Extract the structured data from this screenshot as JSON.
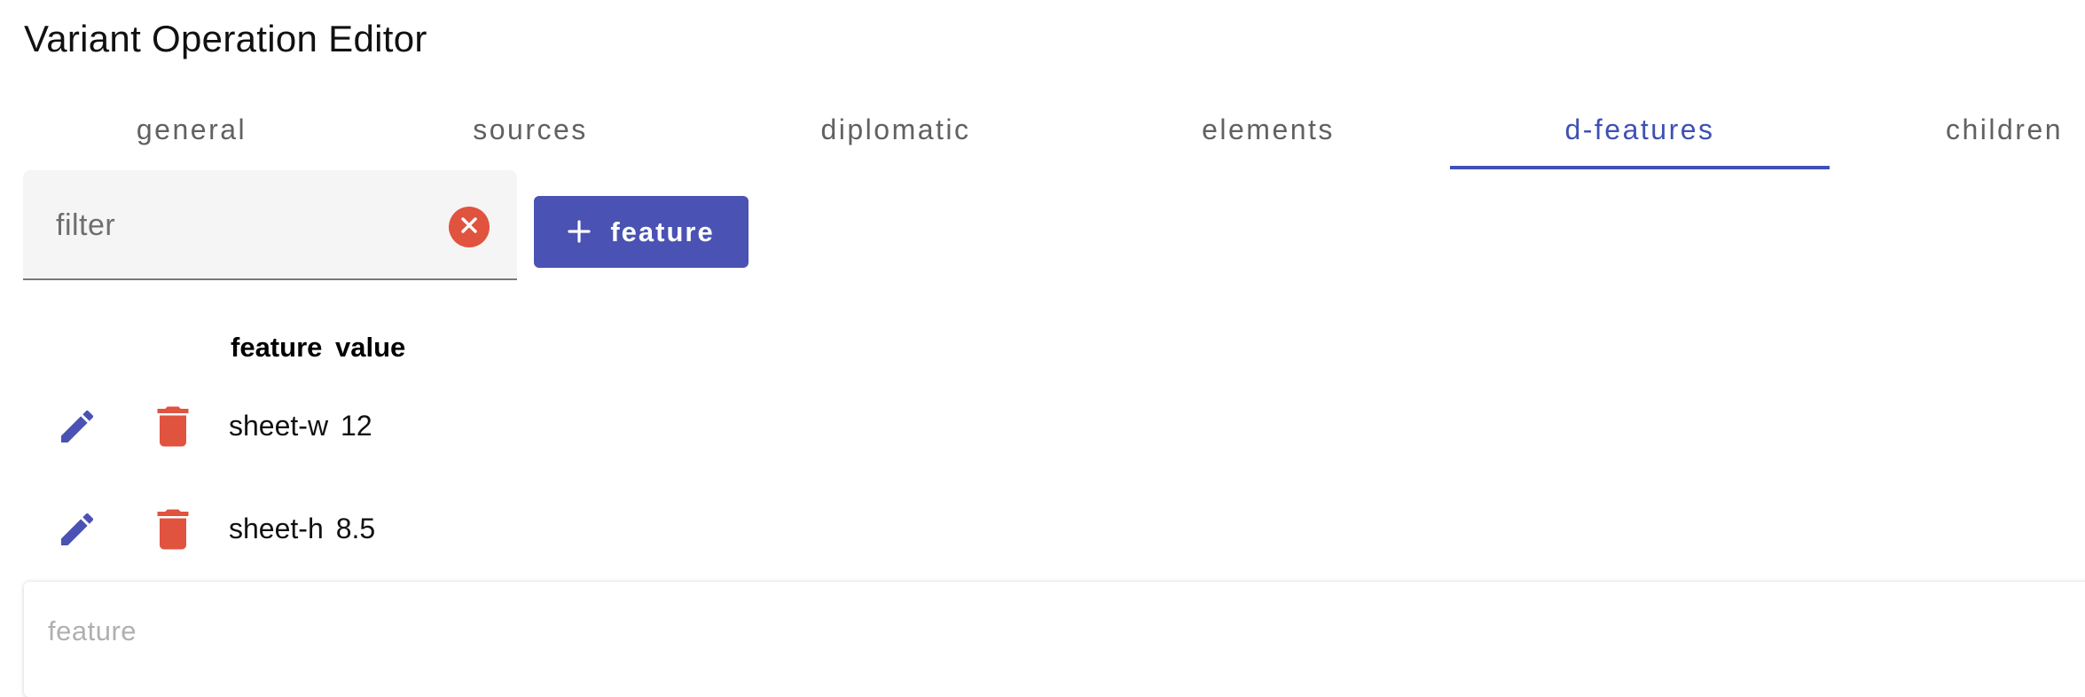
{
  "app": {
    "title": "Variant Operation Editor"
  },
  "tabs": [
    {
      "label": "general"
    },
    {
      "label": "sources"
    },
    {
      "label": "diplomatic"
    },
    {
      "label": "elements"
    },
    {
      "label": "d-features",
      "active": true
    },
    {
      "label": "children"
    }
  ],
  "filter": {
    "placeholder": "filter",
    "value": ""
  },
  "toolbar": {
    "add_label": "feature",
    "add_icon": "plus-icon"
  },
  "table": {
    "headers": [
      "feature",
      "value"
    ],
    "rows": [
      {
        "feature": "sheet-w",
        "value": "12"
      },
      {
        "feature": "sheet-h",
        "value": "8.5"
      }
    ]
  },
  "editor": {
    "feature_label": "feature"
  },
  "colors": {
    "accent": "#3f51b5",
    "danger": "#e0533f",
    "tab_text": "#616161"
  },
  "icons": {
    "edit": "pencil-icon",
    "delete": "trash-icon",
    "clear": "close-circle-icon"
  }
}
